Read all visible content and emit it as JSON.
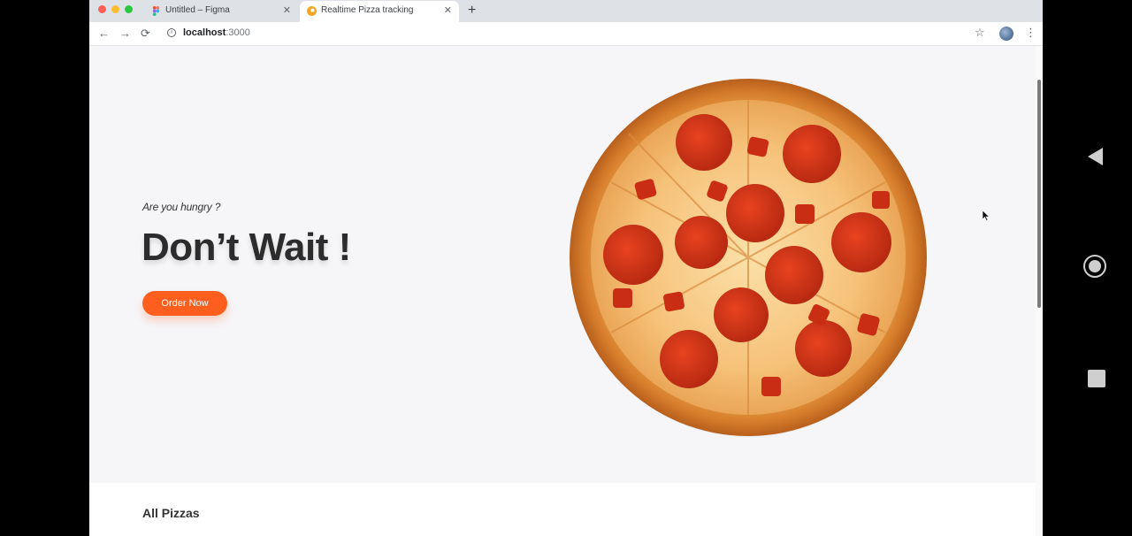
{
  "browser": {
    "tabs": [
      {
        "title": "Untitled – Figma",
        "icon": "figma-icon",
        "active": false
      },
      {
        "title": "Realtime Pizza tracking",
        "icon": "pizza-favicon",
        "active": true
      }
    ],
    "url_host": "localhost",
    "url_port": ":3000"
  },
  "hero": {
    "tagline": "Are you hungry ?",
    "headline": "Don’t Wait !",
    "cta_label": "Order Now"
  },
  "section": {
    "title": "All Pizzas"
  },
  "colors": {
    "accent": "#fe5f1e",
    "heading": "#2c2c2c",
    "page_bg": "#f6f6f8"
  },
  "icons": {
    "back": "←",
    "forward": "→",
    "reload": "⟳",
    "star": "☆",
    "menu": "⋮",
    "close": "✕",
    "new_tab": "+"
  }
}
